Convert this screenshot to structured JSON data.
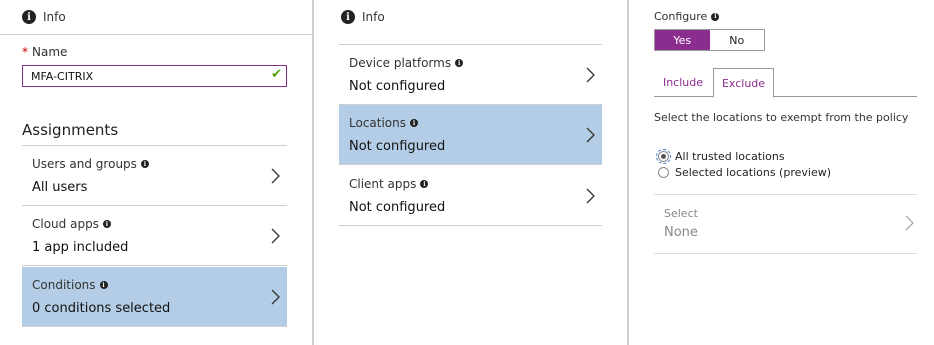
{
  "panel1": {
    "info_label": "Info",
    "name_label": "Name",
    "name_required_mark": "*",
    "name_value": "MFA-CITRIX",
    "section_title": "Assignments",
    "items": [
      {
        "label": "Users and groups",
        "value": "All users",
        "selected": false
      },
      {
        "label": "Cloud apps",
        "value": "1 app included",
        "selected": false
      },
      {
        "label": "Conditions",
        "value": "0 conditions selected",
        "selected": true
      }
    ]
  },
  "panel2": {
    "info_label": "Info",
    "items": [
      {
        "label": "Device platforms",
        "value": "Not configured",
        "selected": false
      },
      {
        "label": "Locations",
        "value": "Not configured",
        "selected": true
      },
      {
        "label": "Client apps",
        "value": "Not configured",
        "selected": false
      }
    ]
  },
  "panel3": {
    "configure_label": "Configure",
    "toggle": {
      "yes": "Yes",
      "no": "No",
      "selected": "Yes"
    },
    "tabs": [
      {
        "label": "Include",
        "active": false
      },
      {
        "label": "Exclude",
        "active": true
      }
    ],
    "description": "Select the locations to exempt from the policy",
    "radios": [
      {
        "label": "All trusted locations",
        "checked": true
      },
      {
        "label": "Selected locations (preview)",
        "checked": false
      }
    ],
    "select": {
      "label": "Select",
      "value": "None"
    }
  },
  "colors": {
    "accent": "#8a2d8f",
    "selected_bg": "#b3cde6",
    "valid_check": "#57a300",
    "required": "#cc0000"
  },
  "icons": [
    "info-icon",
    "checkmark-icon",
    "chevron-right-icon"
  ]
}
